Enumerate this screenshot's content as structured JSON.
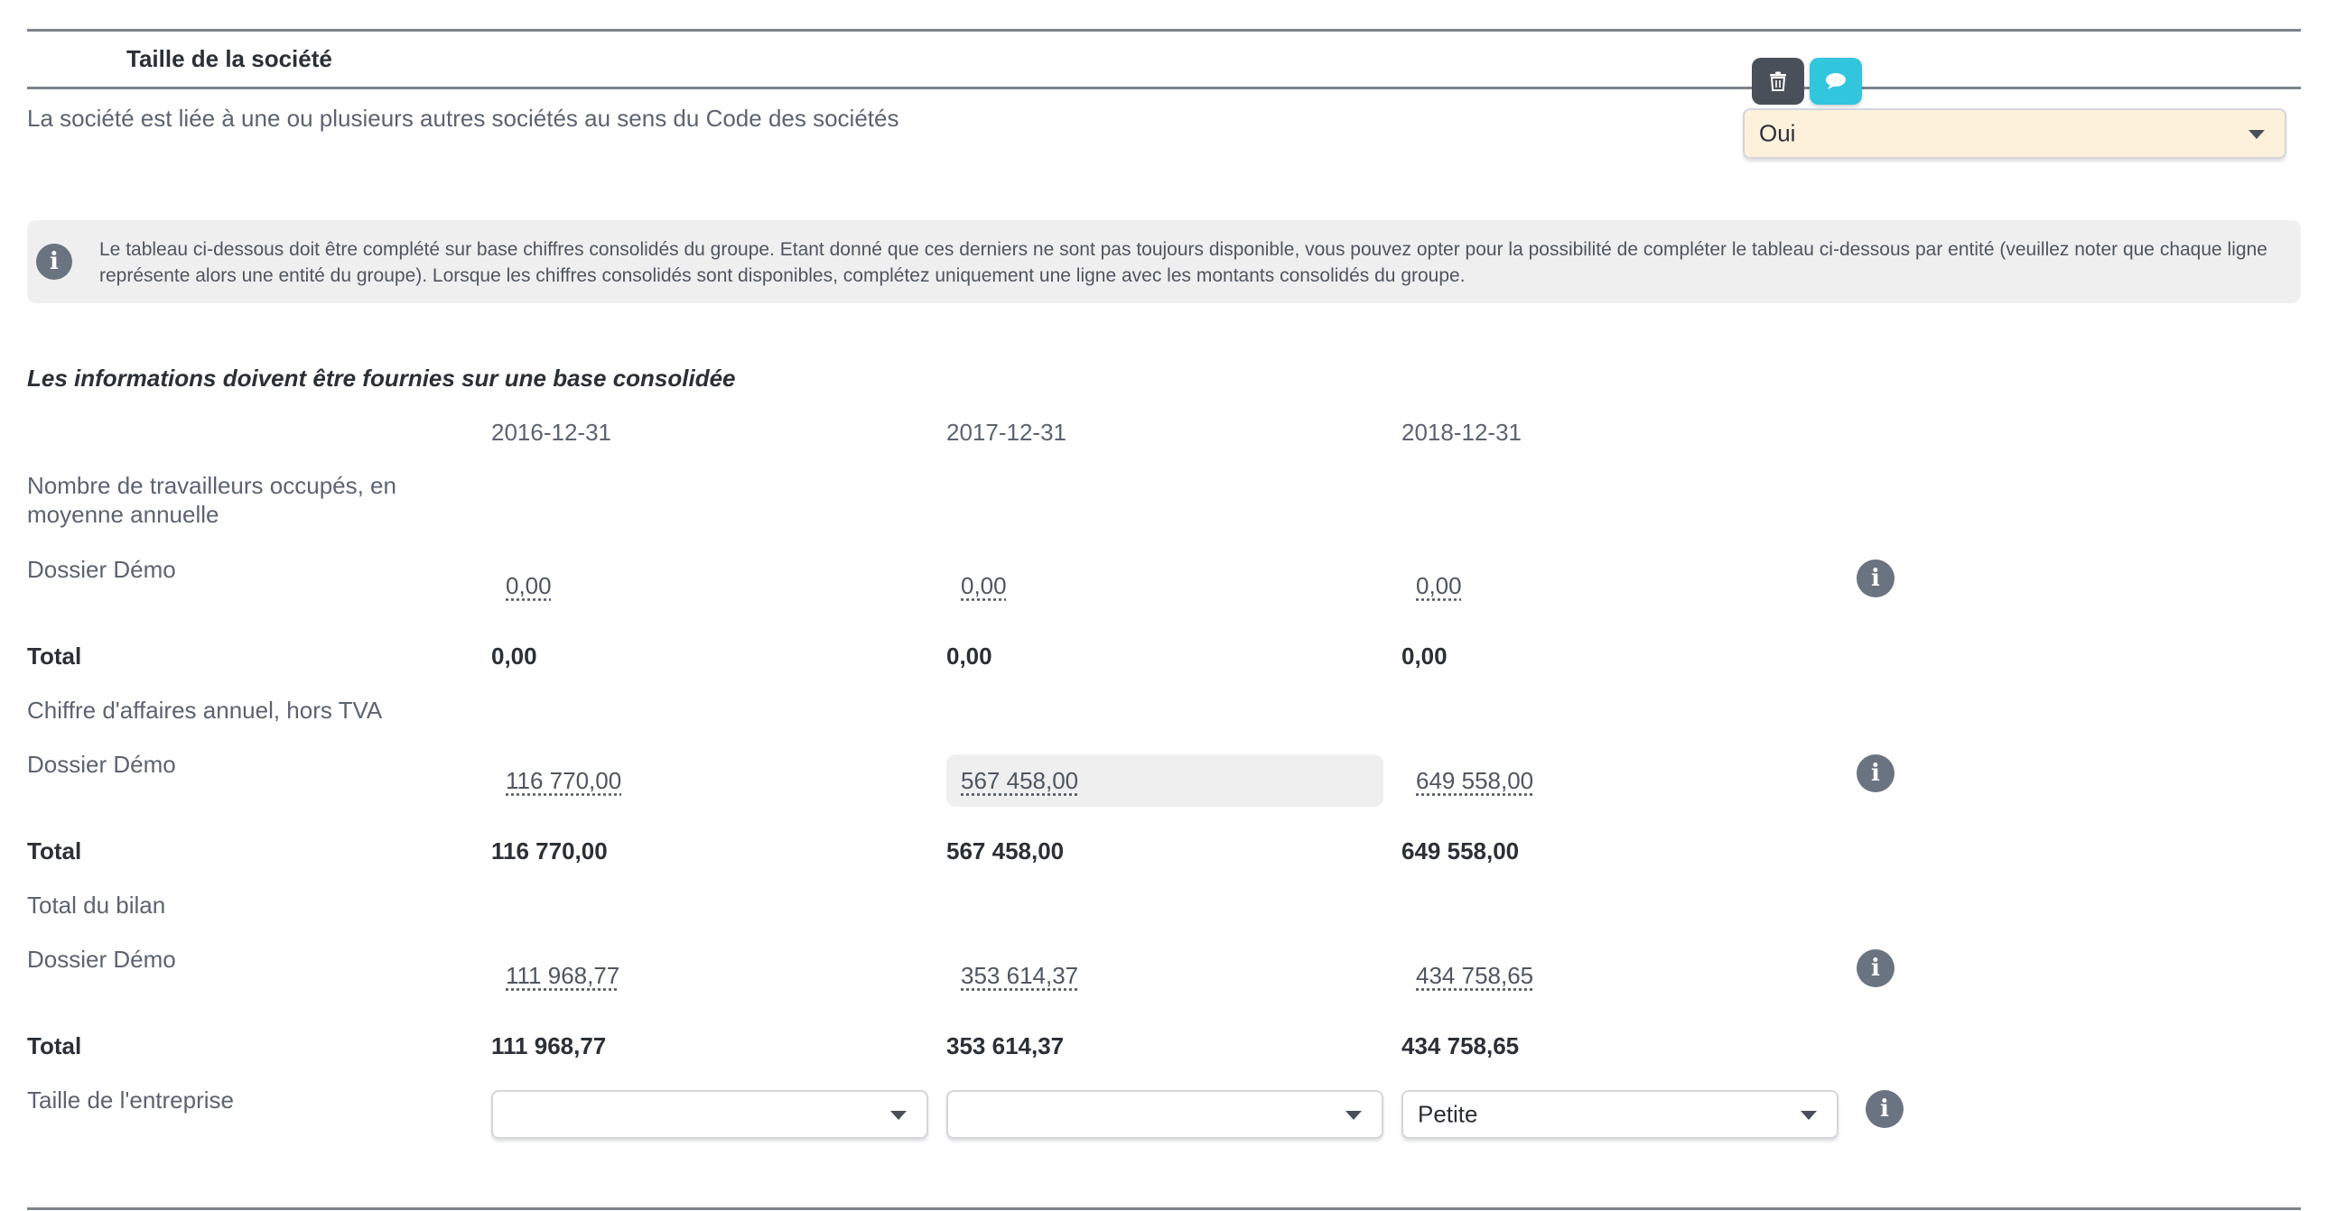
{
  "section": {
    "title": "Taille de la société"
  },
  "toolbar": {
    "delete_icon": "trash-icon",
    "comment_icon": "comment-icon"
  },
  "question": {
    "label": "La société est liée à une ou plusieurs autres sociétés au sens du Code des sociétés",
    "value": "Oui"
  },
  "info": {
    "text": "Le tableau ci-dessous doit être complété sur base chiffres consolidés du groupe. Etant donné que ces derniers ne sont pas toujours disponible, vous pouvez opter pour la possibilité de compléter le tableau ci-dessous par entité (veuillez noter que chaque ligne représente alors une entité du groupe). Lorsque les chiffres consolidés sont disponibles, complétez uniquement une ligne avec les montants consolidés du groupe."
  },
  "table": {
    "subtitle": "Les informations doivent être fournies sur une base consolidée",
    "years": [
      "2016-12-31",
      "2017-12-31",
      "2018-12-31"
    ],
    "sections": [
      {
        "title": "Nombre de travailleurs occupés, en moyenne annuelle",
        "entity": "Dossier Démo",
        "values": [
          "0,00",
          "0,00",
          "0,00"
        ],
        "total_label": "Total",
        "totals": [
          "0,00",
          "0,00",
          "0,00"
        ]
      },
      {
        "title": "Chiffre d'affaires annuel, hors TVA",
        "entity": "Dossier Démo",
        "values": [
          "116 770,00",
          "567 458,00",
          "649 558,00"
        ],
        "total_label": "Total",
        "totals": [
          "116 770,00",
          "567 458,00",
          "649 558,00"
        ]
      },
      {
        "title": "Total du bilan",
        "entity": "Dossier Démo",
        "values": [
          "111 968,77",
          "353 614,37",
          "434 758,65"
        ],
        "total_label": "Total",
        "totals": [
          "111 968,77",
          "353 614,37",
          "434 758,65"
        ]
      }
    ],
    "size": {
      "label": "Taille de l'entreprise",
      "values": [
        "",
        "",
        "Petite"
      ]
    }
  }
}
